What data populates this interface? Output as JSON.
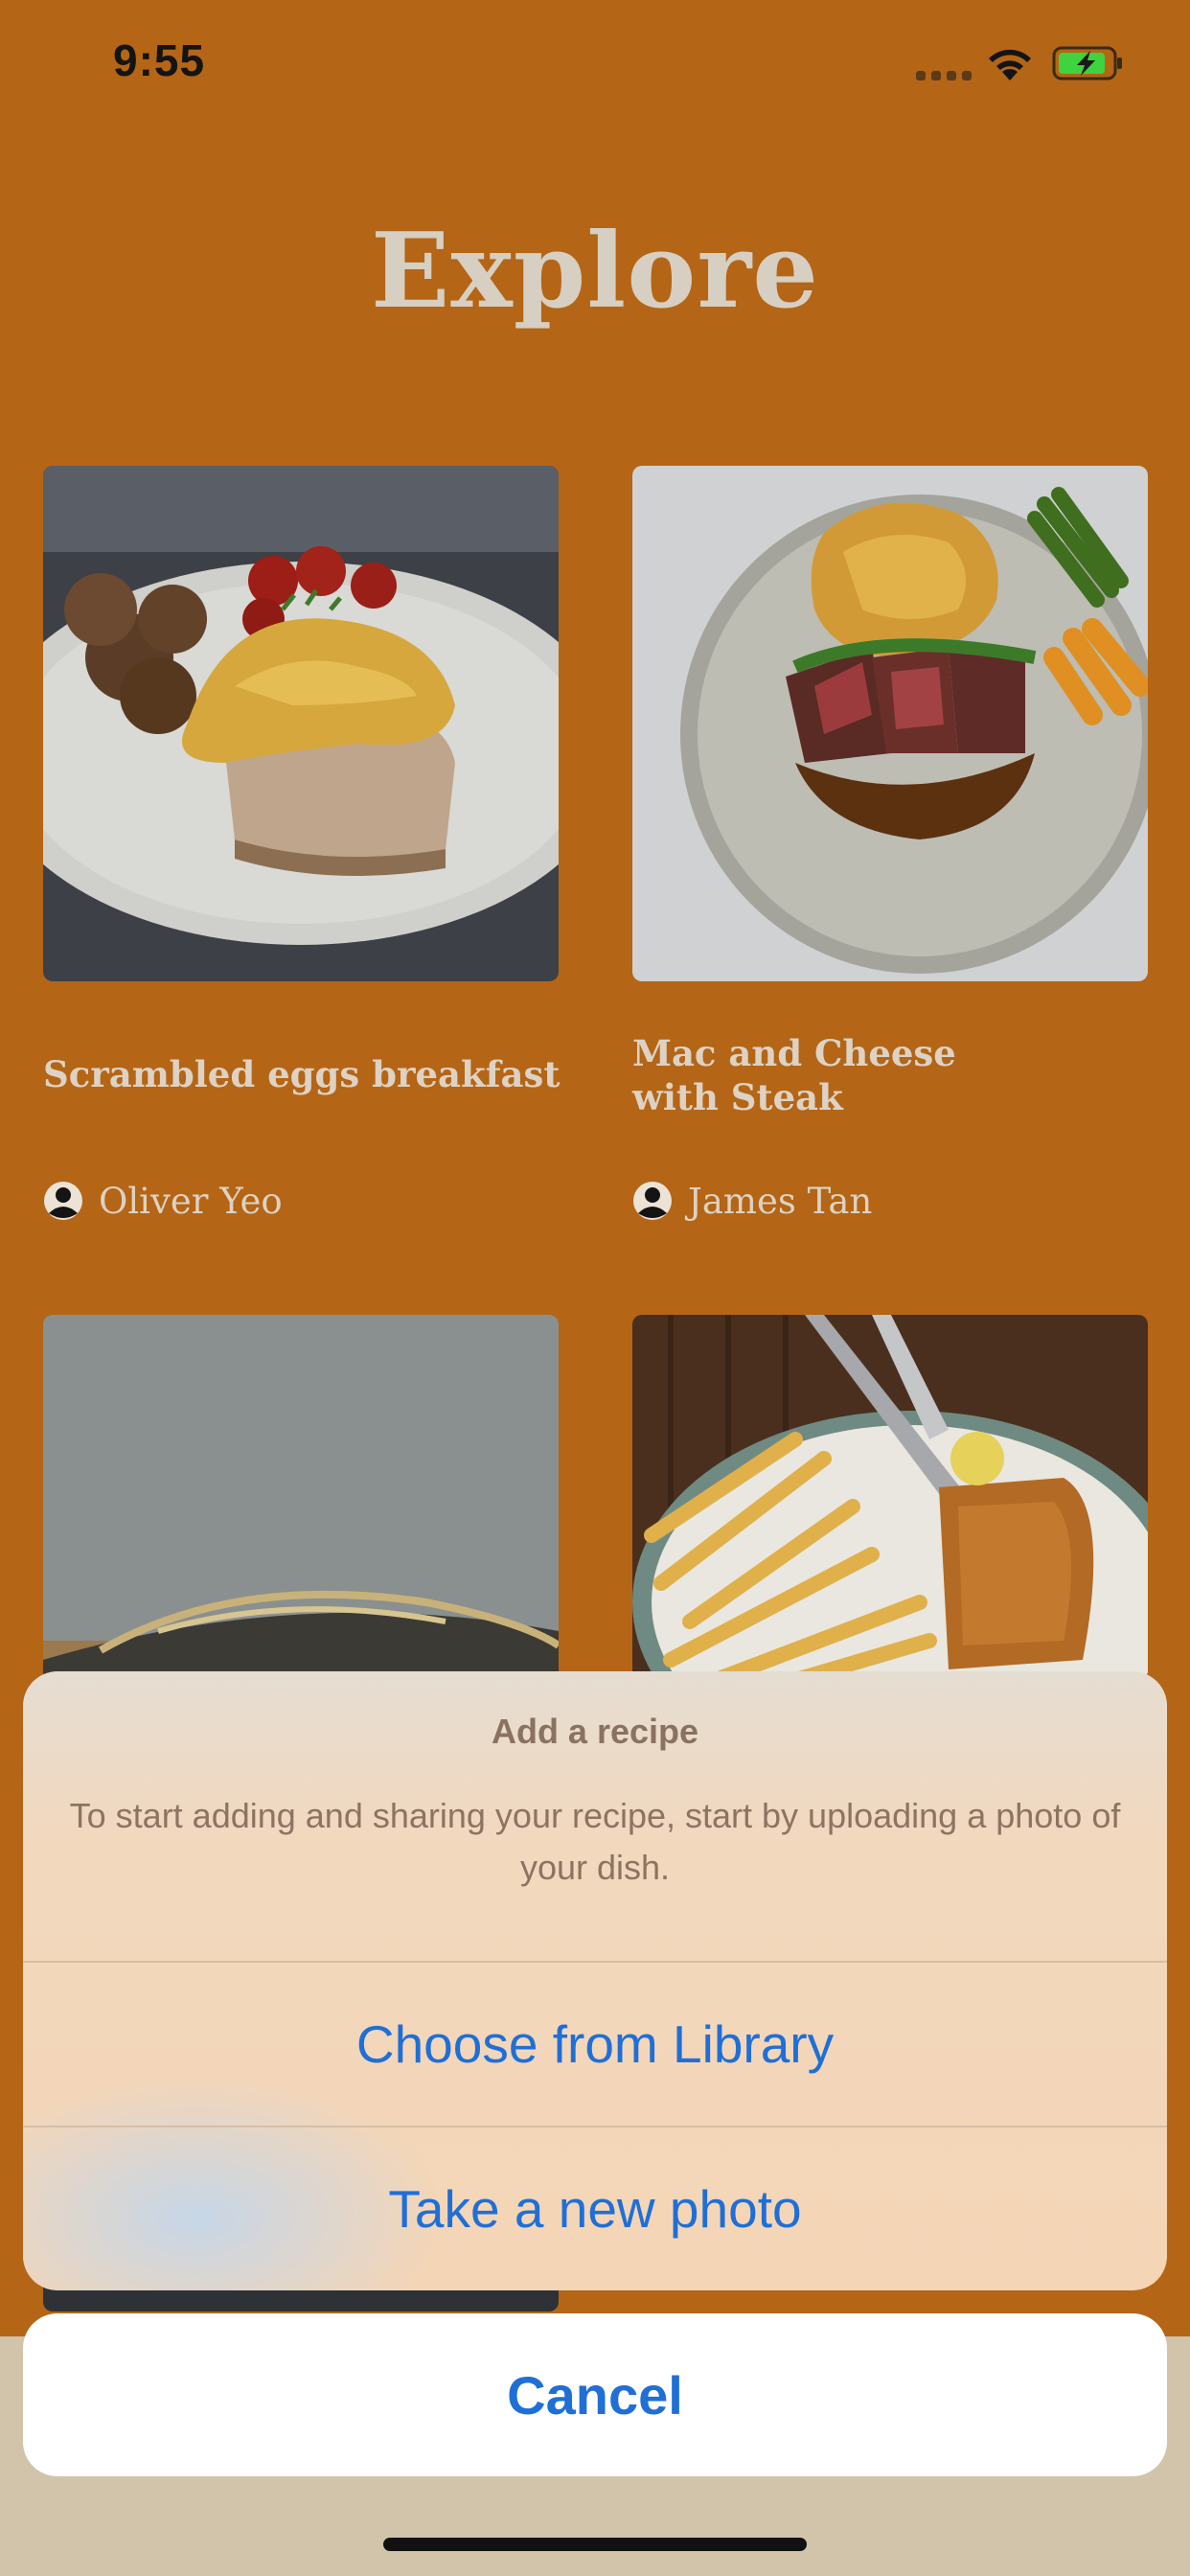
{
  "status_bar": {
    "time": "9:55"
  },
  "header": {
    "title": "Explore"
  },
  "recipes": [
    {
      "title": "Scrambled eggs breakfast",
      "author": "Oliver Yeo"
    },
    {
      "title": "Mac and Cheese\nwith Steak",
      "author": "James Tan"
    }
  ],
  "action_sheet": {
    "title": "Add a recipe",
    "message": "To start adding and sharing your recipe, start by uploading a photo of your dish.",
    "options": [
      "Choose from Library",
      "Take a new photo"
    ],
    "cancel": "Cancel"
  },
  "colors": {
    "background": "#b46516",
    "accent": "#1f6fd6",
    "sheet": "#f4d5b6"
  }
}
